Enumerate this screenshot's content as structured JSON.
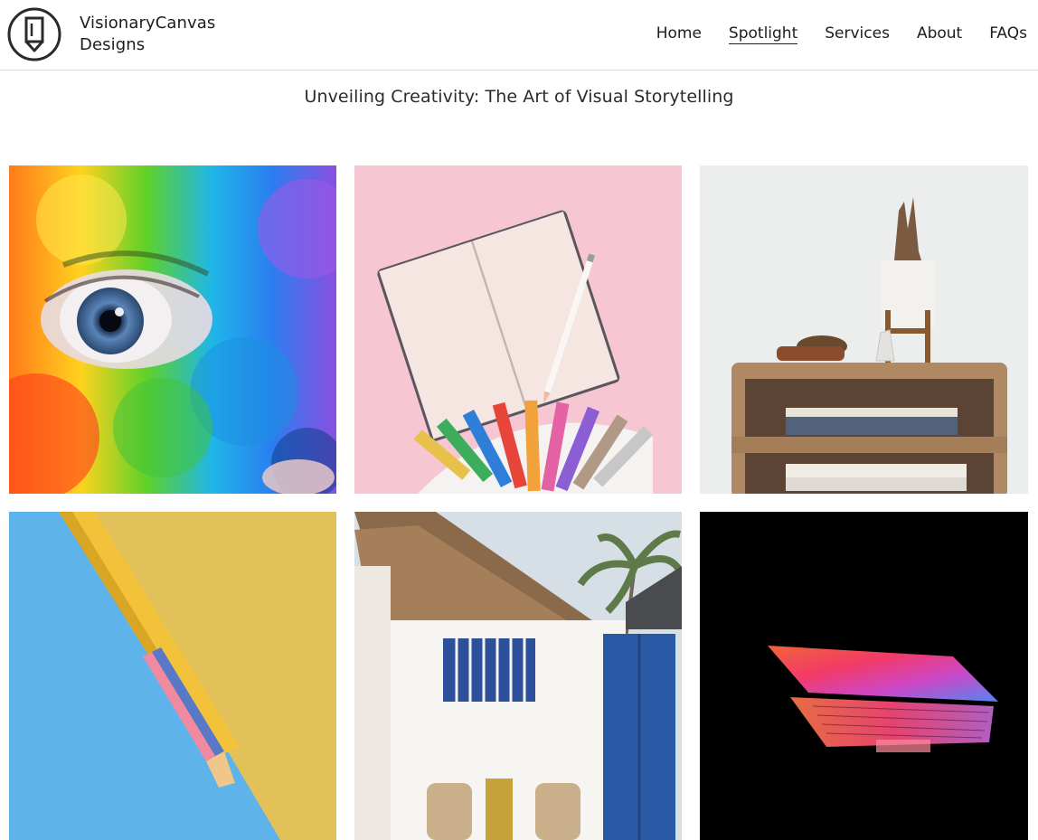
{
  "header": {
    "brand_line1": "VisionaryCanvas",
    "brand_line2": "Designs",
    "logo_icon": "pencil-badge-icon",
    "nav": [
      {
        "label": "Home",
        "active": false
      },
      {
        "label": "Spotlight",
        "active": true
      },
      {
        "label": "Services",
        "active": false
      },
      {
        "label": "About",
        "active": false
      },
      {
        "label": "FAQs",
        "active": false
      }
    ]
  },
  "main": {
    "title": "Unveiling Creativity: The Art of Visual Storytelling"
  },
  "colors": {
    "text": "#1d1d1d",
    "divider": "#d9d9d9",
    "background": "#ffffff"
  }
}
